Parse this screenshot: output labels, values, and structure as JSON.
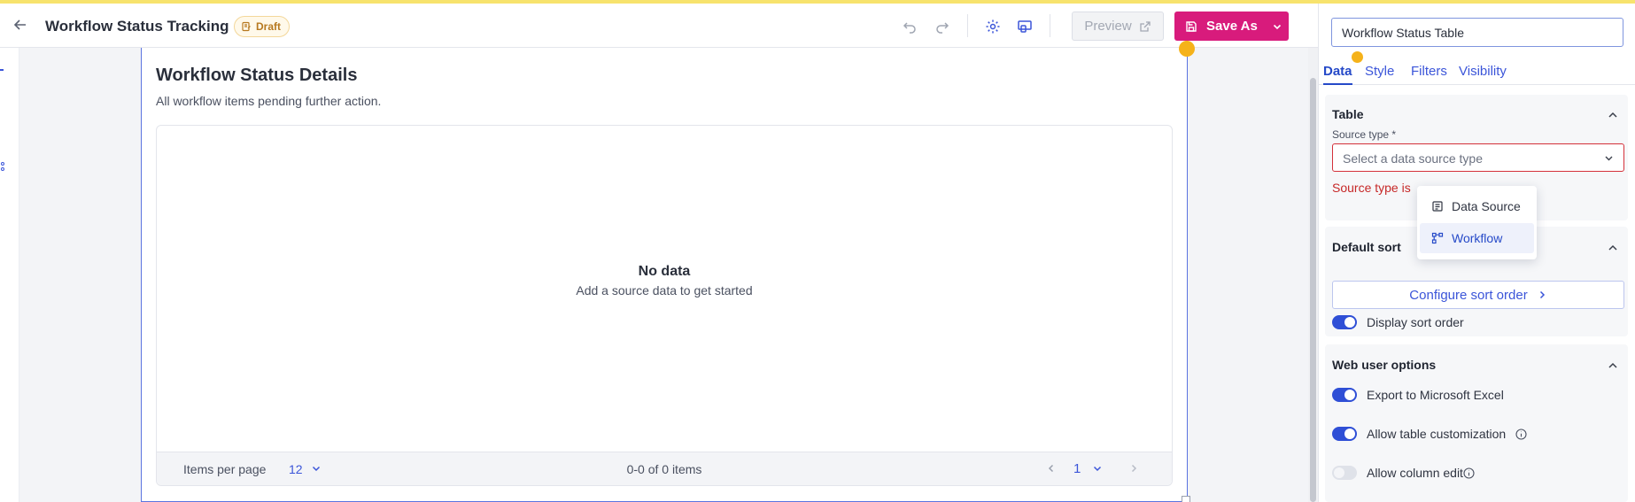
{
  "header": {
    "title": "Workflow Status Tracking",
    "status_badge": "Draft",
    "preview_label": "Preview",
    "save_as_label": "Save As"
  },
  "card": {
    "title": "Workflow Status Details",
    "subtitle": "All workflow items pending further action.",
    "empty_title": "No data",
    "empty_subtitle": "Add a source data to get started"
  },
  "pager": {
    "items_per_page_label": "Items per page",
    "items_per_page_value": "12",
    "count_text": "0-0 of 0 items",
    "page_number": "1"
  },
  "props": {
    "name_value": "Workflow Status Table",
    "tabs": [
      {
        "label": "Data",
        "active": true
      },
      {
        "label": "Style",
        "active": false
      },
      {
        "label": "Filters",
        "active": false
      },
      {
        "label": "Visibility",
        "active": false
      }
    ],
    "table_section": {
      "title": "Table",
      "source_type_label": "Source type *",
      "source_type_placeholder": "Select a data source type",
      "error_text": "Source type is"
    },
    "dropdown_options": [
      {
        "label": "Data Source",
        "icon": "data-source-icon",
        "selected": false
      },
      {
        "label": "Workflow",
        "icon": "workflow-icon",
        "selected": true
      }
    ],
    "sort_section": {
      "title": "Default sort",
      "configure_label": "Configure sort order",
      "display_sort_label": "Display sort order",
      "display_sort_on": true
    },
    "web_section": {
      "title": "Web user options",
      "export_label": "Export to Microsoft Excel",
      "export_on": true,
      "customize_label": "Allow table customization",
      "customize_on": true,
      "column_edit_label": "Allow column edit",
      "column_edit_on": false
    }
  },
  "colors": {
    "accent": "#3b55d9",
    "save_button": "#d81b7c",
    "error": "#c62828",
    "badge": "#b7791f"
  }
}
